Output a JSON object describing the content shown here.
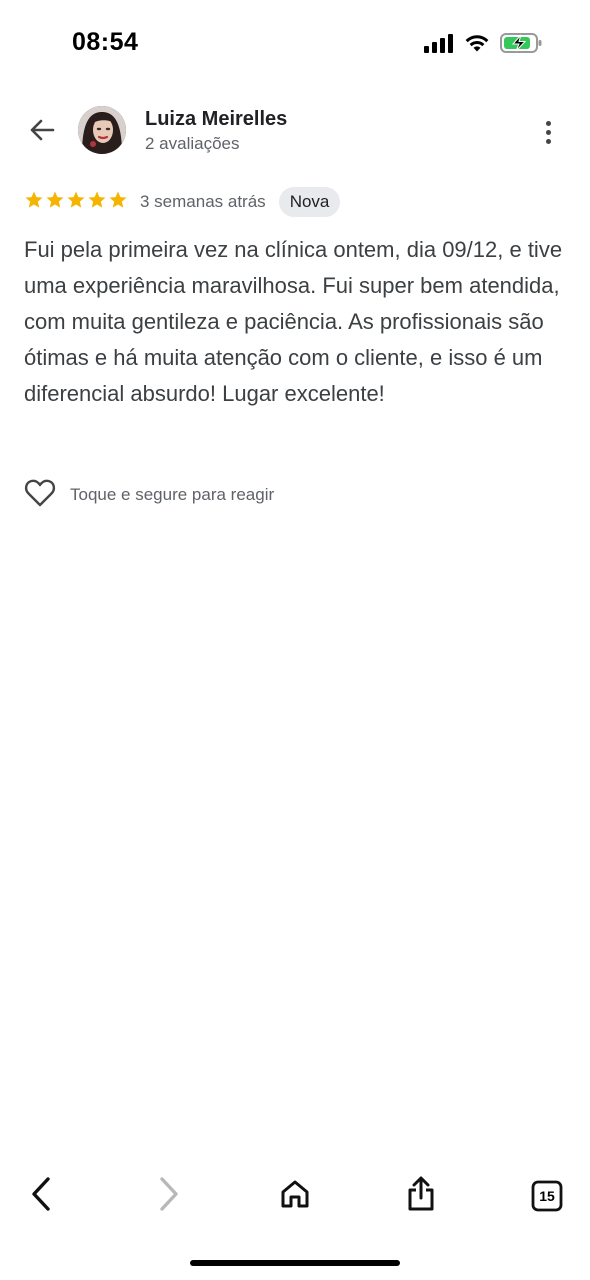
{
  "status_bar": {
    "time": "08:54"
  },
  "header": {
    "reviewer_name": "Luiza Meirelles",
    "review_count": "2 avaliações"
  },
  "review": {
    "rating": 5,
    "max_rating": 5,
    "time_ago": "3 semanas atrás",
    "badge": "Nova",
    "text": "Fui pela primeira vez na clínica ontem, dia 09/12, e tive uma experiência maravilhosa. Fui super bem atendida, com muita gentileza e paciência. As profissionais são ótimas e há muita atenção com o cliente, e isso é um diferencial absurdo! Lugar excelente!"
  },
  "reaction": {
    "label": "Toque e segure para reagir"
  },
  "toolbar": {
    "tabs_count": "15"
  },
  "icons": {
    "back": "arrow-left-icon",
    "more": "more-vertical-icon",
    "star": "star-icon",
    "heart": "heart-outline-icon",
    "browser_back": "chevron-left-icon",
    "browser_forward": "chevron-right-icon",
    "home": "home-icon",
    "share": "share-icon",
    "tabs": "tabs-icon"
  },
  "colors": {
    "star": "#f4b400",
    "badge_bg": "#e8eaed",
    "battery_fill": "#34c759",
    "text_primary": "#202124",
    "text_secondary": "#5f6368"
  }
}
